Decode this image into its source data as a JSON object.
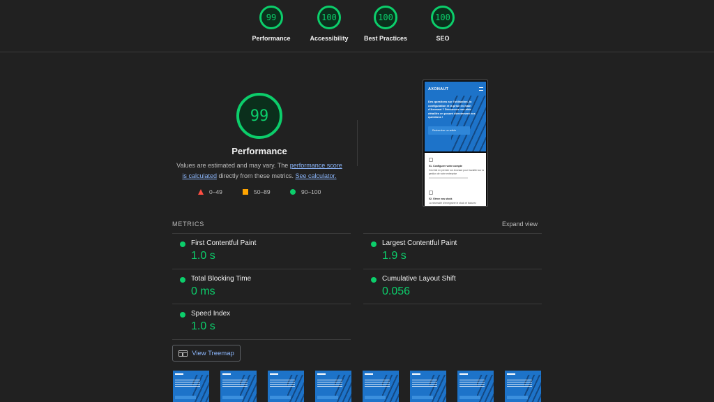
{
  "summary": [
    {
      "score": "99",
      "label": "Performance"
    },
    {
      "score": "100",
      "label": "Accessibility"
    },
    {
      "score": "100",
      "label": "Best Practices"
    },
    {
      "score": "100",
      "label": "SEO"
    }
  ],
  "performance": {
    "score": "99",
    "title": "Performance",
    "desc_1": "Values are estimated and may vary. The ",
    "desc_link_1": "performance score is calculated",
    "desc_2": " directly from these metrics. ",
    "desc_link_2": "See calculator."
  },
  "legend": {
    "fail": "0–49",
    "average": "50–89",
    "pass": "90–100"
  },
  "colors": {
    "pass": "#0cce6b",
    "average": "#ffa400",
    "fail": "#ff4e42",
    "link": "#8ab4f8",
    "background": "#212121"
  },
  "preview": {
    "logo": "AXONAUT",
    "headline": "Des questions sur l'utilisation, la configuration et la prise en main d'Axonaut ? Découvrez nos aide détaillés en posant directement vos questions !",
    "search_placeholder": "Rechercher un article",
    "item_1_title": "01. Configurer votre compte",
    "item_1_desc": "Ceci fait en premier sur Axonaut pour travailler sur la gestion de votre entreprise",
    "item_2_title": "02. Gérez vos stock",
    "item_2_desc": "La nécessité d'enregistrer le stock et facturez"
  },
  "metrics": {
    "header": "METRICS",
    "expand": "Expand view",
    "fcp": {
      "label": "First Contentful Paint",
      "value": "1.0 s"
    },
    "lcp": {
      "label": "Largest Contentful Paint",
      "value": "1.9 s"
    },
    "tbt": {
      "label": "Total Blocking Time",
      "value": "0 ms"
    },
    "cls": {
      "label": "Cumulative Layout Shift",
      "value": "0.056"
    },
    "si": {
      "label": "Speed Index",
      "value": "1.0 s"
    }
  },
  "treemap": {
    "label": "View Treemap",
    "icon": "treemap-icon"
  }
}
